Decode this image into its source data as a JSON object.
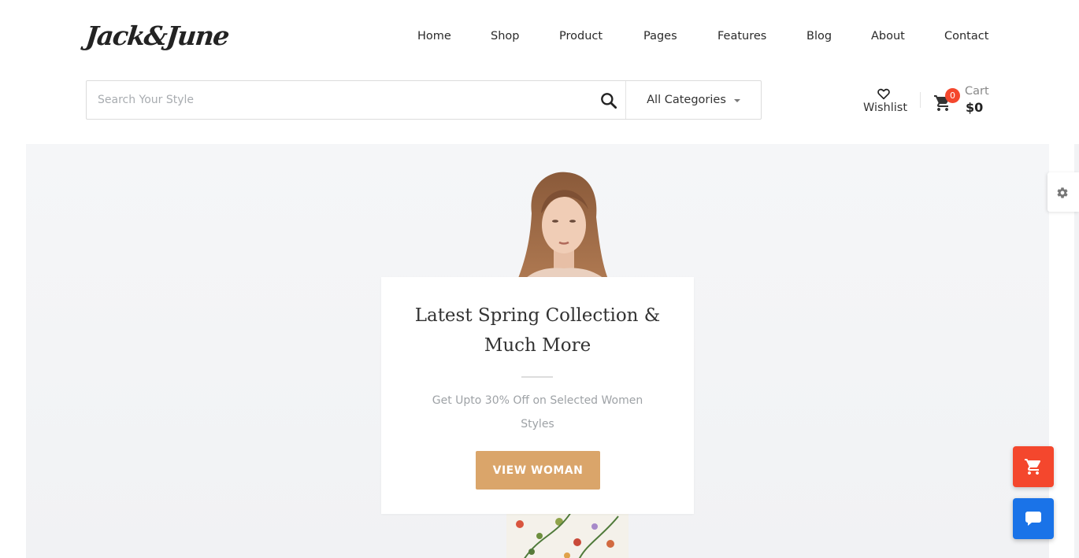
{
  "brand": {
    "logo_text": "Jack&June"
  },
  "nav": {
    "items": [
      {
        "label": "Home"
      },
      {
        "label": "Shop"
      },
      {
        "label": "Product"
      },
      {
        "label": "Pages"
      },
      {
        "label": "Features"
      },
      {
        "label": "Blog"
      },
      {
        "label": "About"
      },
      {
        "label": "Contact"
      }
    ]
  },
  "search": {
    "placeholder": "Search Your Style",
    "value": "",
    "category_selected": "All Categories",
    "icon": "search-icon"
  },
  "header_actions": {
    "wishlist_label": "Wishlist",
    "wishlist_icon": "heart-icon",
    "cart_label": "Cart",
    "cart_count": "0",
    "cart_total": "$0",
    "cart_icon": "shopping-cart-icon"
  },
  "hero": {
    "title": "Latest Spring Collection & Much More",
    "subtitle": "Get Upto 30% Off on Selected Women Styles",
    "cta_label": "VIEW WOMAN"
  },
  "floating": {
    "settings_icon": "gear-icon",
    "cart_fab_icon": "shopping-cart-icon",
    "chat_fab_icon": "chat-icon"
  },
  "colors": {
    "accent_button": "#daa56a",
    "badge_red": "#f4472d",
    "chat_blue": "#1a73e8"
  }
}
